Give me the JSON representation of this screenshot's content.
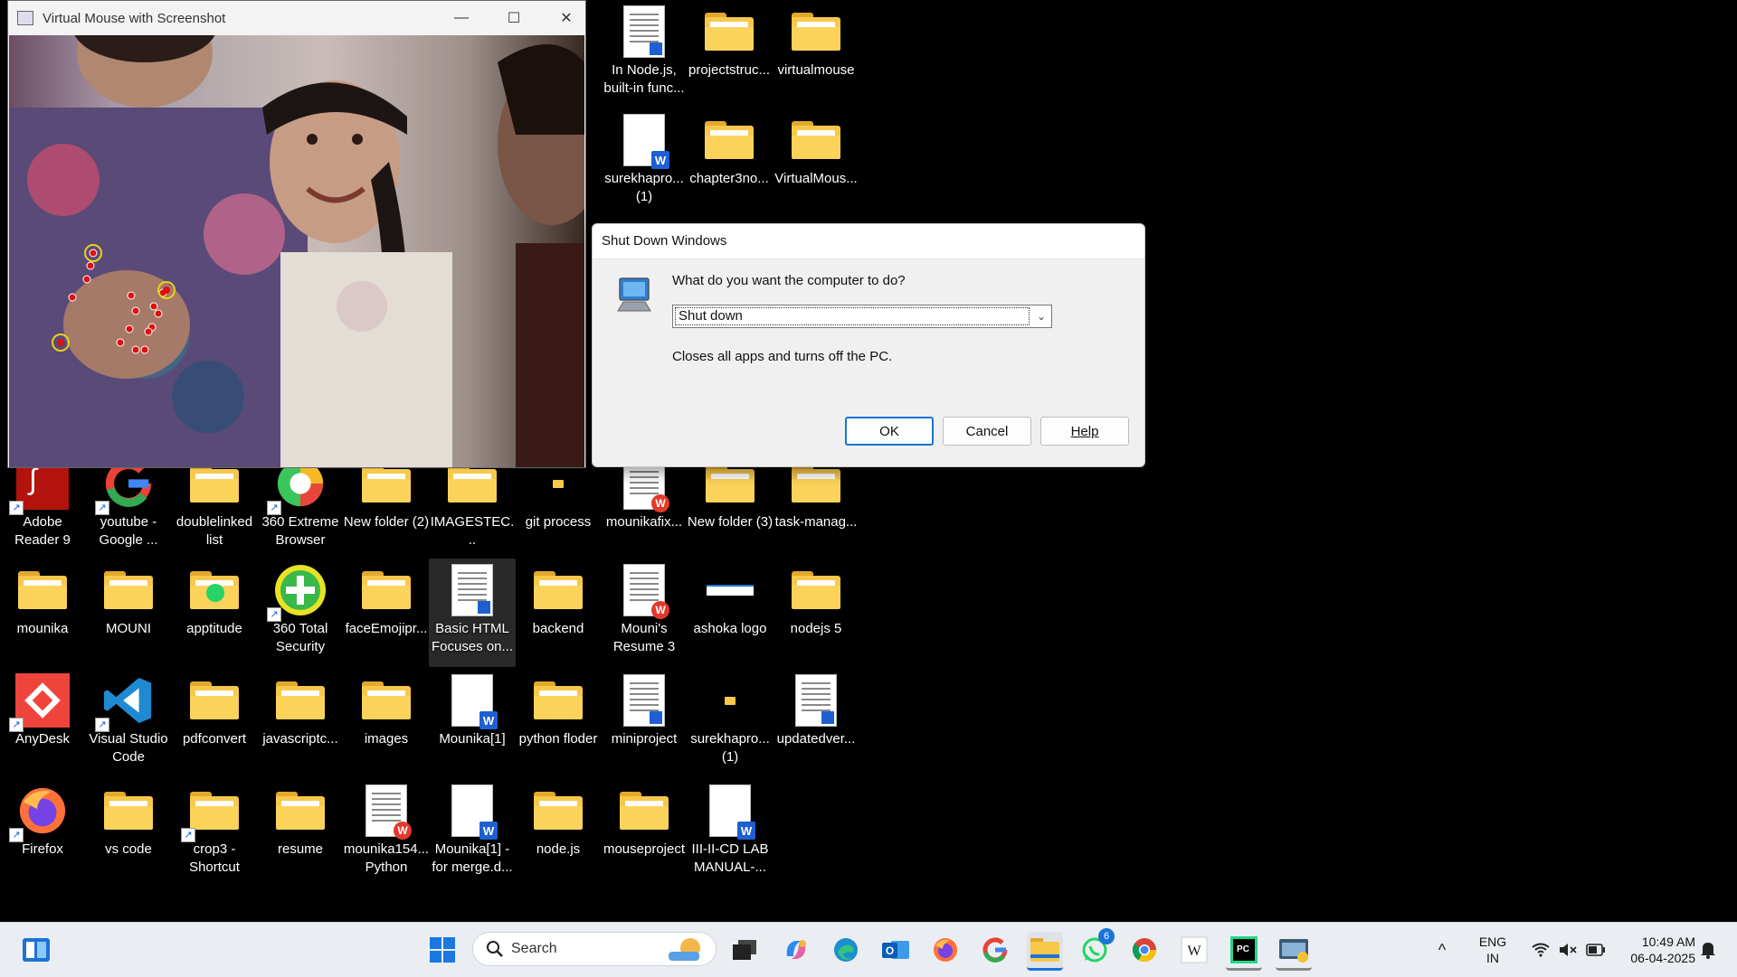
{
  "camera_window": {
    "title": "Virtual Mouse with Screenshot",
    "minimize": "—",
    "maximize": "☐",
    "close": "✕"
  },
  "dialog": {
    "title": "Shut Down Windows",
    "question": "What do you want the computer to do?",
    "selected_option": "Shut down",
    "description": "Closes all apps and turns off the PC.",
    "ok": "OK",
    "cancel": "Cancel",
    "help": "Help"
  },
  "desktop_top": [
    {
      "label": "-",
      "type": "none"
    },
    {
      "label": "In Node.js, built-in func...",
      "type": "doc"
    },
    {
      "label": "projectstruc...",
      "type": "folder"
    },
    {
      "label": "virtualmouse",
      "type": "folder"
    },
    {
      "label": "...",
      "type": "none"
    },
    {
      "label": "surekhapro... (1)",
      "type": "doc-w"
    },
    {
      "label": "chapter3no...",
      "type": "folder"
    },
    {
      "label": "VirtualMous...",
      "type": "folder"
    }
  ],
  "desktop_rows": [
    [
      {
        "label": "Adobe Reader 9",
        "type": "adobe"
      },
      {
        "label": "youtube - Google ...",
        "type": "google"
      },
      {
        "label": "doublelinked list",
        "type": "folder"
      },
      {
        "label": "360 Extreme Browser",
        "type": "browser360"
      },
      {
        "label": "New folder (2)",
        "type": "folder"
      },
      {
        "label": "IMAGESTEC...",
        "type": "folder"
      },
      {
        "label": "git process",
        "type": "folder-small"
      },
      {
        "label": "mounikafix...",
        "type": "doc-wps"
      },
      {
        "label": "New folder (3)",
        "type": "folder"
      },
      {
        "label": "task-manag...",
        "type": "folder"
      }
    ],
    [
      {
        "label": "mounika",
        "type": "folder"
      },
      {
        "label": "MOUNI",
        "type": "folder"
      },
      {
        "label": "apptitude",
        "type": "folder-wa"
      },
      {
        "label": "360 Total Security",
        "type": "sec360"
      },
      {
        "label": "faceEmojipr...",
        "type": "folder"
      },
      {
        "label": "Basic HTML Focuses on...",
        "type": "doc",
        "selected": true
      },
      {
        "label": "backend",
        "type": "folder"
      },
      {
        "label": "Mouni's Resume 3",
        "type": "doc-wps"
      },
      {
        "label": "ashoka logo",
        "type": "logo"
      },
      {
        "label": "nodejs 5",
        "type": "folder"
      }
    ],
    [
      {
        "label": "AnyDesk",
        "type": "anydesk"
      },
      {
        "label": "Visual Studio Code",
        "type": "vscode"
      },
      {
        "label": "pdfconvert",
        "type": "folder"
      },
      {
        "label": "javascriptc...",
        "type": "folder"
      },
      {
        "label": "images",
        "type": "folder"
      },
      {
        "label": "Mounika[1]",
        "type": "doc-w"
      },
      {
        "label": "python floder",
        "type": "folder"
      },
      {
        "label": "miniproject",
        "type": "doc"
      },
      {
        "label": "surekhapro... (1)",
        "type": "folder-small"
      },
      {
        "label": "updatedver...",
        "type": "doc"
      }
    ],
    [
      {
        "label": "Firefox",
        "type": "firefox"
      },
      {
        "label": "vs code",
        "type": "folder"
      },
      {
        "label": "crop3 - Shortcut",
        "type": "folder-sc"
      },
      {
        "label": "resume",
        "type": "folder"
      },
      {
        "label": "mounika154... Python",
        "type": "doc-wps"
      },
      {
        "label": "Mounika[1] - for merge.d...",
        "type": "doc-w"
      },
      {
        "label": "node.js",
        "type": "folder"
      },
      {
        "label": "mouseproject",
        "type": "folder"
      },
      {
        "label": "III-II-CD LAB MANUAL-...",
        "type": "doc-w"
      },
      {
        "label": "",
        "type": "none"
      }
    ]
  ],
  "taskbar": {
    "search_placeholder": "Search",
    "whatsapp_badge": "6",
    "lang_line1": "ENG",
    "lang_line2": "IN",
    "time": "10:49 AM",
    "date": "06-04-2025",
    "chevron": "^"
  }
}
